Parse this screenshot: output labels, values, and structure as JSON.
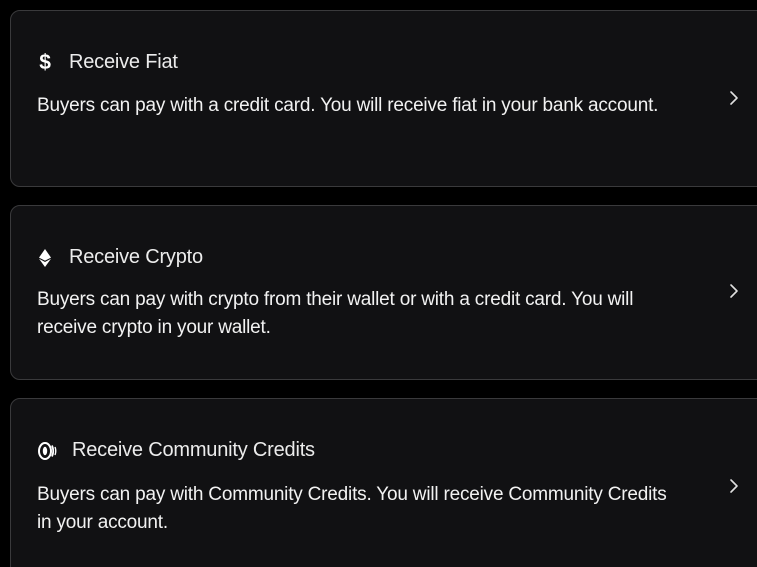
{
  "options": [
    {
      "title": "Receive Fiat",
      "icon": "dollar-icon",
      "description": "Buyers can pay with a credit card. You will receive fiat in your bank account."
    },
    {
      "title": "Receive Crypto",
      "icon": "ethereum-icon",
      "description": "Buyers can pay with crypto from their wallet or with a credit card. You will receive crypto in your wallet."
    },
    {
      "title": "Receive Community Credits",
      "icon": "coins-icon",
      "description": "Buyers can pay with Community Credits. You will receive Community Credits in your account."
    }
  ],
  "colors": {
    "background": "#000000",
    "card": "#111113",
    "border": "#3a3a3c",
    "text": "#f2f2f2"
  }
}
